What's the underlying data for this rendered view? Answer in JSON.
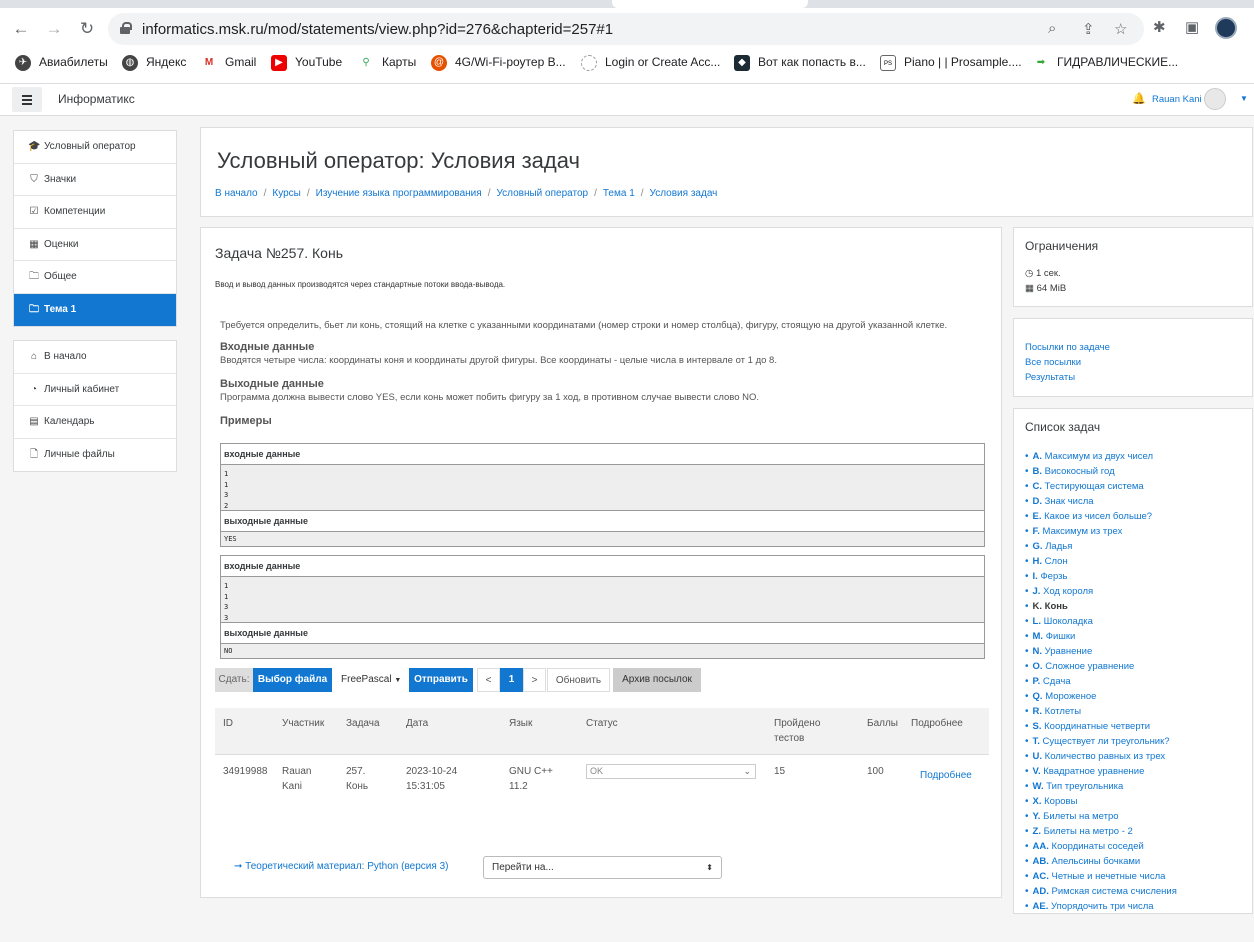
{
  "browser": {
    "url": "informatics.msk.ru/mod/statements/view.php?id=276&chapterid=257#1",
    "bookmarks": [
      "Авиабилеты",
      "Яндекс",
      "Gmail",
      "YouTube",
      "Карты",
      "4G/Wi-Fi-роутер B...",
      "Login or Create Acc...",
      "Вот как попасть в...",
      "Piano | | Prosample....",
      "ГИДРАВЛИЧЕСКИЕ..."
    ]
  },
  "topbar": {
    "brand": "Информатикс",
    "user": "Rauan Kani"
  },
  "sidebar": {
    "group1": [
      {
        "icon": "graduation-cap-icon",
        "glyph": "🎓",
        "label": "Условный оператор"
      },
      {
        "icon": "shield-icon",
        "glyph": "⛉",
        "label": "Значки"
      },
      {
        "icon": "checkbox-icon",
        "glyph": "☑",
        "label": "Компетенции"
      },
      {
        "icon": "table-icon",
        "glyph": "▦",
        "label": "Оценки"
      },
      {
        "icon": "folder-icon",
        "glyph": "🗀",
        "label": "Общее"
      },
      {
        "icon": "folder-icon",
        "glyph": "🗀",
        "label": "Тема 1",
        "active": true
      }
    ],
    "group2": [
      {
        "icon": "home-icon",
        "glyph": "⌂",
        "label": "В начало"
      },
      {
        "icon": "dashboard-icon",
        "glyph": "◔",
        "label": "Личный кабинет"
      },
      {
        "icon": "calendar-icon",
        "glyph": "▤",
        "label": "Календарь"
      },
      {
        "icon": "file-icon",
        "glyph": "🗋",
        "label": "Личные файлы"
      }
    ]
  },
  "header": {
    "title": "Условный оператор: Условия задач",
    "breadcrumbs": [
      "В начало",
      "Курсы",
      "Изучение языка программирования",
      "Условный оператор",
      "Тема 1",
      "Условия задач"
    ]
  },
  "problem": {
    "title": "Задача №257. Конь",
    "io": "Ввод и вывод данных производятся через стандартные потоки ввода-вывода.",
    "statement": "Требуется определить, бьет ли конь, стоящий на клетке с указанными координатами (номер строки и номер столбца), фигуру, стоящую на другой указанной клетке.",
    "input_title": "Входные данные",
    "input_text": "Вводятся четыре числа: координаты коня и координаты другой фигуры. Все координаты - целые числа в интервале от 1 до 8.",
    "output_title": "Выходные данные",
    "output_text": "Программа должна вывести слово YES, если конь может побить фигуру за 1 ход, в противном случае вывести слово NO.",
    "examples_title": "Примеры",
    "in_label": "входные данные",
    "out_label": "выходные данные",
    "examples": [
      {
        "input": [
          "1",
          "1",
          "3",
          "2"
        ],
        "output": "YES"
      },
      {
        "input": [
          "1",
          "1",
          "3",
          "3"
        ],
        "output": "NO"
      }
    ]
  },
  "submit": {
    "label": "Сдать:",
    "choose_file": "Выбор файла",
    "language": "FreePascal",
    "send": "Отправить",
    "prev": "<",
    "page": "1",
    "next": ">",
    "refresh": "Обновить",
    "archive": "Архив посылок"
  },
  "submissions": {
    "headers": [
      "ID",
      "Участник",
      "Задача",
      "Дата",
      "Язык",
      "Статус",
      "Пройдено тестов",
      "Баллы",
      "Подробнее"
    ],
    "rows": [
      {
        "id": "34919988",
        "user": "Rauan Kani",
        "problem": "257. Конь",
        "date": "2023-10-24 15:31:05",
        "lang": "GNU C++ 11.2",
        "status": "OK",
        "tests": "15",
        "score": "100",
        "details": "Подробнее"
      }
    ]
  },
  "footer": {
    "prev_link": "➞ Теоретический материал: Python (версия 3)",
    "jump": "Перейти на..."
  },
  "limits": {
    "title": "Ограничения",
    "time": "1 сек.",
    "memory": "64 MiB"
  },
  "links": [
    "Посылки по задаче",
    "Все посылки",
    "Результаты"
  ],
  "tasklist": {
    "title": "Список задач",
    "items": [
      {
        "k": "A.",
        "t": "Максимум из двух чисел"
      },
      {
        "k": "B.",
        "t": "Високосный год"
      },
      {
        "k": "C.",
        "t": "Тестирующая система"
      },
      {
        "k": "D.",
        "t": "Знак числа"
      },
      {
        "k": "E.",
        "t": "Какое из чисел больше?"
      },
      {
        "k": "F.",
        "t": "Максимум из трех"
      },
      {
        "k": "G.",
        "t": "Ладья"
      },
      {
        "k": "H.",
        "t": "Слон"
      },
      {
        "k": "I.",
        "t": "Ферзь"
      },
      {
        "k": "J.",
        "t": "Ход короля"
      },
      {
        "k": "K.",
        "t": "Конь",
        "current": true
      },
      {
        "k": "L.",
        "t": "Шоколадка"
      },
      {
        "k": "M.",
        "t": "Фишки"
      },
      {
        "k": "N.",
        "t": "Уравнение"
      },
      {
        "k": "O.",
        "t": "Сложное уравнение"
      },
      {
        "k": "P.",
        "t": "Сдача"
      },
      {
        "k": "Q.",
        "t": "Мороженое"
      },
      {
        "k": "R.",
        "t": "Котлеты"
      },
      {
        "k": "S.",
        "t": "Координатные четверти"
      },
      {
        "k": "T.",
        "t": "Существует ли треугольник?"
      },
      {
        "k": "U.",
        "t": "Количество равных из трех"
      },
      {
        "k": "V.",
        "t": "Квадратное уравнение"
      },
      {
        "k": "W.",
        "t": "Тип треугольника"
      },
      {
        "k": "X.",
        "t": "Коровы"
      },
      {
        "k": "Y.",
        "t": "Билеты на метро"
      },
      {
        "k": "Z.",
        "t": "Билеты на метро - 2"
      },
      {
        "k": "AA.",
        "t": "Координаты соседей"
      },
      {
        "k": "AB.",
        "t": "Апельсины бочками"
      },
      {
        "k": "AC.",
        "t": "Четные и нечетные числа"
      },
      {
        "k": "AD.",
        "t": "Римская система счисления"
      },
      {
        "k": "AE.",
        "t": "Упорядочить три числа"
      }
    ]
  },
  "colors": {
    "accent": "#1177d1",
    "grey_button": "#ccc"
  }
}
